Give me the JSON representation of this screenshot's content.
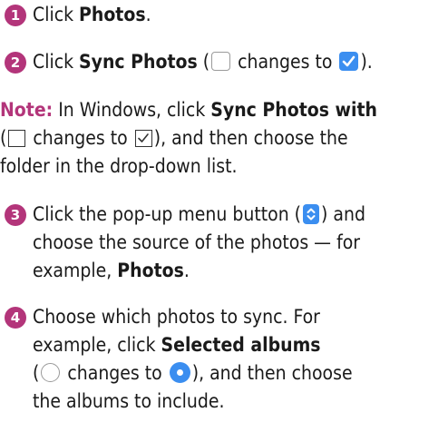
{
  "steps": [
    {
      "number": "1",
      "lines": [
        {
          "pre": "Click ",
          "bold": "Photos",
          "post": "."
        }
      ]
    },
    {
      "number": "2",
      "pre": "Click ",
      "bold": "Sync Photos",
      "open": " (",
      "mid": " changes to ",
      "close": ")."
    },
    {
      "number": "3",
      "line1_pre": "Click the pop-up menu button (",
      "line1_post": ") and",
      "line2": "choose the source of the photos — for",
      "line3_pre": "example, ",
      "line3_bold": "Photos",
      "line3_post": "."
    },
    {
      "number": "4",
      "line1": "Choose which photos to sync. For",
      "line2_pre": "example, click ",
      "line2_bold": "Selected albums",
      "line3_open": "(",
      "line3_mid": " changes to ",
      "line3_post": "), and then choose",
      "line4": "the albums to include."
    }
  ],
  "note": {
    "label": "Note:",
    "line1_pre": " In Windows, click ",
    "line1_bold": "Sync Photos with",
    "line2_open": "(",
    "line2_mid": " changes to ",
    "line2_post": "), and then choose the",
    "line3": "folder in the drop-down list."
  },
  "icons": {
    "mac_checkbox_empty": "checkbox-empty-icon",
    "mac_checkbox_checked": "checkbox-checked-icon",
    "win_checkbox_empty": "windows-checkbox-empty-icon",
    "win_checkbox_checked": "windows-checkbox-checked-icon",
    "popup_menu": "popup-menu-button-icon",
    "radio_empty": "radio-empty-icon",
    "radio_selected": "radio-selected-icon"
  },
  "colors": {
    "accent": "#b3357a",
    "control_blue": "#3b8ef0",
    "text": "#1a1a1a"
  }
}
